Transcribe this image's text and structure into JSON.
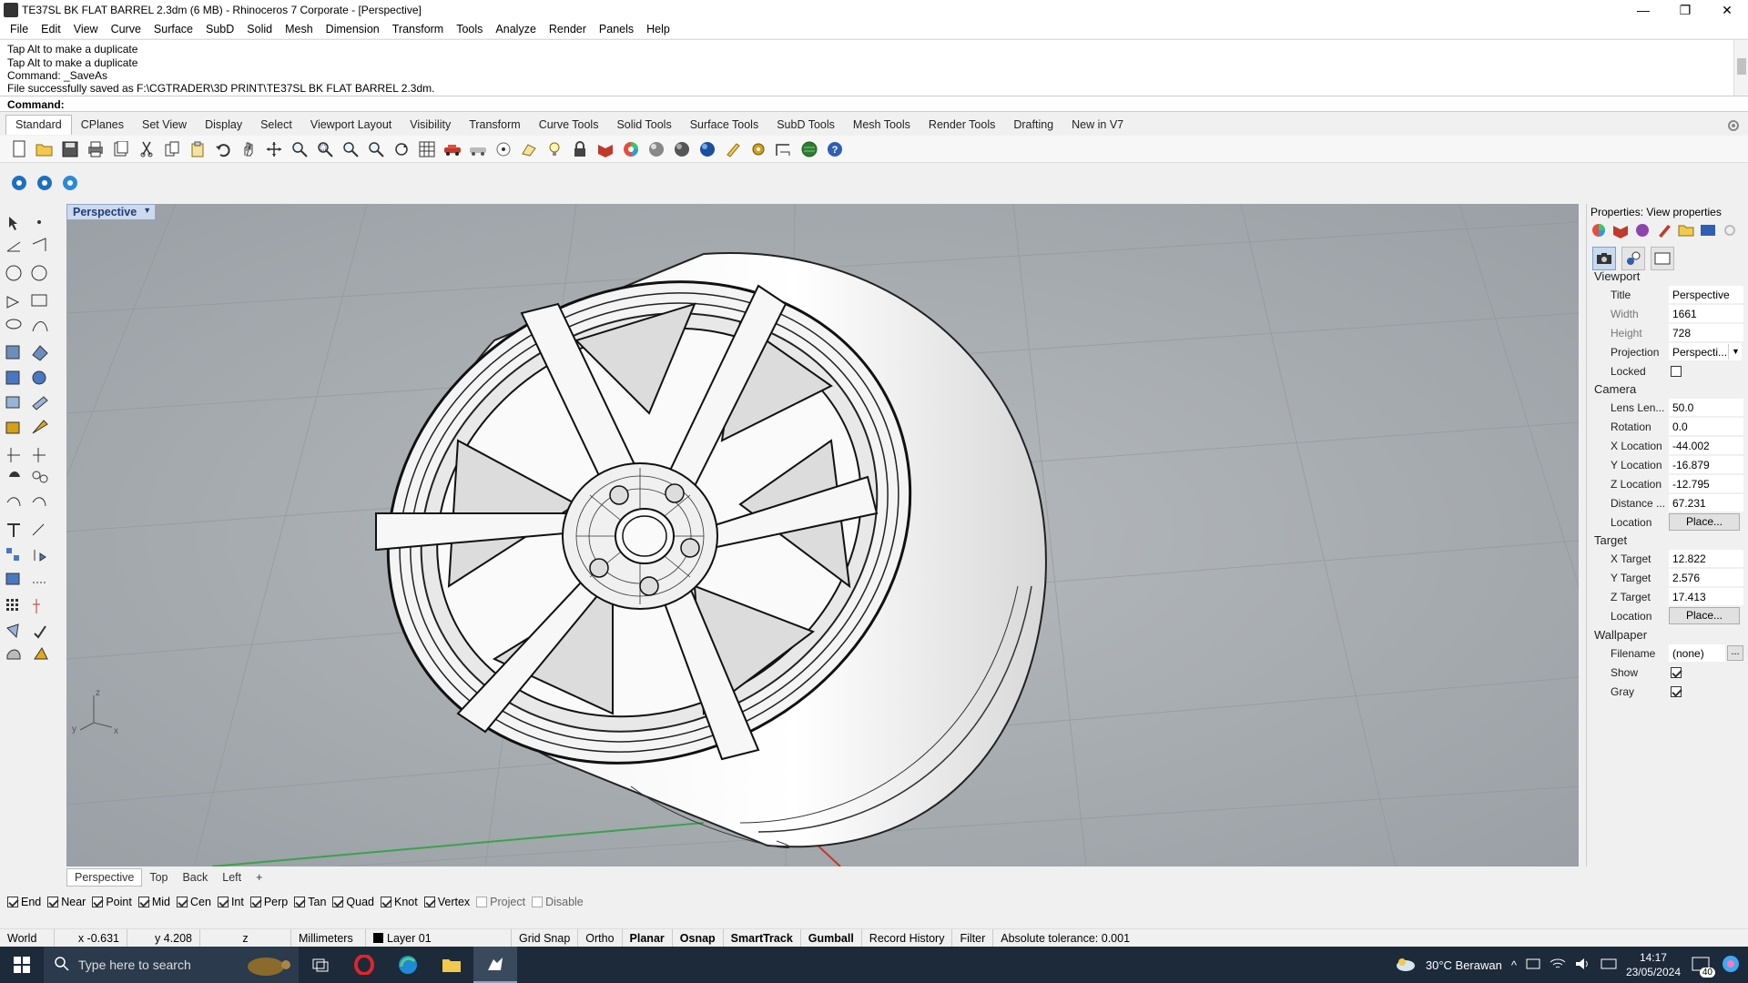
{
  "window": {
    "title": "TE37SL BK FLAT BARREL 2.3dm (6 MB) - Rhinoceros 7 Corporate - [Perspective]",
    "minimize": "—",
    "maximize": "❐",
    "close": "✕"
  },
  "menu": [
    "File",
    "Edit",
    "View",
    "Curve",
    "Surface",
    "SubD",
    "Solid",
    "Mesh",
    "Dimension",
    "Transform",
    "Tools",
    "Analyze",
    "Render",
    "Panels",
    "Help"
  ],
  "command_history": [
    "Tap Alt to make a duplicate",
    "Tap Alt to make a duplicate",
    "Command: _SaveAs",
    "File successfully saved as F:\\CGTRADER\\3D PRINT\\TE37SL BK FLAT BARREL 2.3dm."
  ],
  "command_prompt": "Command:",
  "toolbar_tabs": [
    "Standard",
    "CPlanes",
    "Set View",
    "Display",
    "Select",
    "Viewport Layout",
    "Visibility",
    "Transform",
    "Curve Tools",
    "Solid Tools",
    "Surface Tools",
    "SubD Tools",
    "Mesh Tools",
    "Render Tools",
    "Drafting",
    "New in V7"
  ],
  "active_tab": "Standard",
  "toolbar_icons": [
    "new-icon",
    "open-icon",
    "save-icon",
    "print-icon",
    "import-icon",
    "cut-icon",
    "copy-icon",
    "paste-icon",
    "undo-icon",
    "pan-icon",
    "move-icon",
    "zoom-icon",
    "zoom-window-icon",
    "zoom-extents-icon",
    "zoom-selected-icon",
    "rotate-view-icon",
    "grid-icon",
    "car-icon",
    "shade-icon",
    "point-icon",
    "cplane-icon",
    "light-icon",
    "lock-icon",
    "material-icon",
    "render-color-icon",
    "sphere-icon",
    "sphere-dark-icon",
    "sphere-blue-icon",
    "pencil-icon",
    "gear-icon",
    "dimension-icon",
    "earth-icon",
    "help-icon"
  ],
  "viewport": {
    "active_name": "Perspective",
    "tabs": [
      "Perspective",
      "Top",
      "Back",
      "Left"
    ],
    "add_tab": "+",
    "axis_labels": {
      "z": "z",
      "y": "y",
      "x": "x"
    }
  },
  "osnaps": [
    {
      "label": "End",
      "on": true
    },
    {
      "label": "Near",
      "on": true
    },
    {
      "label": "Point",
      "on": true
    },
    {
      "label": "Mid",
      "on": true
    },
    {
      "label": "Cen",
      "on": true
    },
    {
      "label": "Int",
      "on": true
    },
    {
      "label": "Perp",
      "on": true
    },
    {
      "label": "Tan",
      "on": true
    },
    {
      "label": "Quad",
      "on": true
    },
    {
      "label": "Knot",
      "on": true
    },
    {
      "label": "Vertex",
      "on": true
    },
    {
      "label": "Project",
      "on": false
    },
    {
      "label": "Disable",
      "on": false
    }
  ],
  "status": {
    "cplane": "World",
    "x": "x -0.631",
    "y": "y 4.208",
    "z": "z",
    "units": "Millimeters",
    "layer": "Layer 01",
    "grid_snap": "Grid Snap",
    "ortho": "Ortho",
    "planar": "Planar",
    "osnap": "Osnap",
    "smarttrack": "SmartTrack",
    "gumball": "Gumball",
    "record_history": "Record History",
    "filter": "Filter",
    "tolerance": "Absolute tolerance: 0.001"
  },
  "properties": {
    "header": "Properties: View properties",
    "viewport_section": "Viewport",
    "camera_section": "Camera",
    "target_section": "Target",
    "wallpaper_section": "Wallpaper",
    "title_label": "Title",
    "title_value": "Perspective",
    "width_label": "Width",
    "width_value": "1661",
    "height_label": "Height",
    "height_value": "728",
    "projection_label": "Projection",
    "projection_value": "Perspecti...",
    "locked_label": "Locked",
    "lens_label": "Lens Len...",
    "lens_value": "50.0",
    "rotation_label": "Rotation",
    "rotation_value": "0.0",
    "xloc_label": "X Location",
    "xloc_value": "-44.002",
    "yloc_label": "Y Location",
    "yloc_value": "-16.879",
    "zloc_label": "Z Location",
    "zloc_value": "-12.795",
    "distance_label": "Distance ...",
    "distance_value": "67.231",
    "location_label": "Location",
    "place_label": "Place...",
    "xtarget_label": "X Target",
    "xtarget_value": "12.822",
    "ytarget_label": "Y Target",
    "ytarget_value": "2.576",
    "ztarget_label": "Z Target",
    "ztarget_value": "17.413",
    "tlocation_label": "Location",
    "tplace_label": "Place...",
    "filename_label": "Filename",
    "filename_value": "(none)",
    "filename_btn": "...",
    "show_label": "Show",
    "gray_label": "Gray"
  },
  "taskbar": {
    "search_placeholder": "Type here to search",
    "weather": "30°C  Berawan",
    "time": "14:17",
    "date": "23/05/2024",
    "notifications": "40"
  },
  "colors": {
    "viewport_bg": "#a8adb1",
    "active_tab_text": "#1f3c7a",
    "taskbar": "#1c2a3a"
  }
}
